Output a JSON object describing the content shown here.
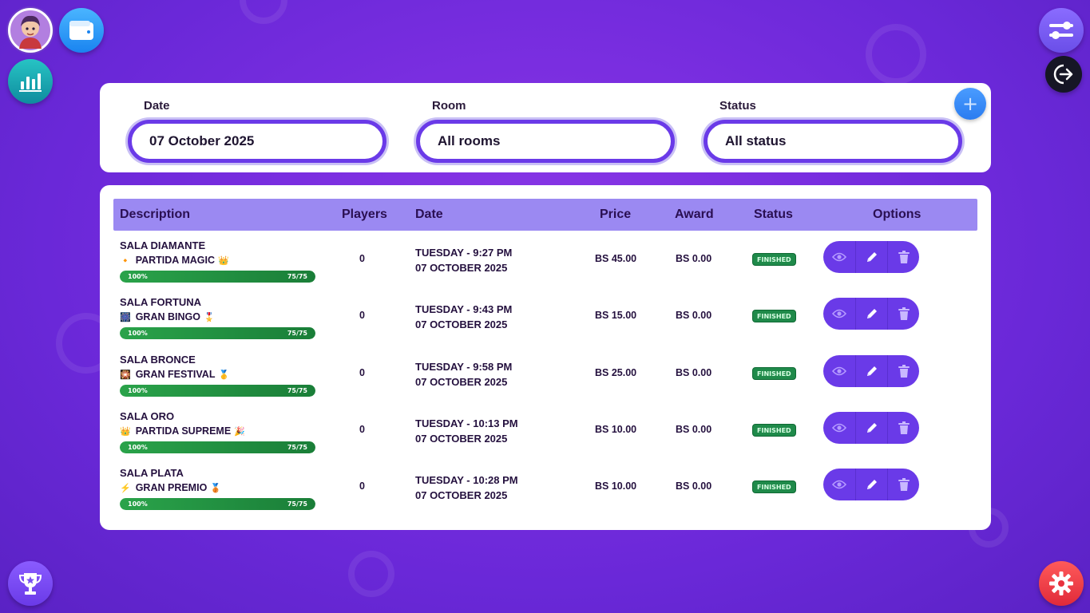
{
  "filters": {
    "date": {
      "label": "Date",
      "value": "07 October 2025"
    },
    "room": {
      "label": "Room",
      "value": "All rooms"
    },
    "status": {
      "label": "Status",
      "value": "All status"
    },
    "add_label": "+"
  },
  "table": {
    "headers": {
      "description": "Description",
      "players": "Players",
      "date": "Date",
      "price": "Price",
      "award": "Award",
      "status": "Status",
      "options": "Options"
    },
    "rows": [
      {
        "sala": "SALA DIAMANTE",
        "icon": "🔸",
        "game": "PARTIDA MAGIC",
        "icon2": "👑",
        "progress_pct": "100%",
        "progress_count": "75/75",
        "progress": 1.0,
        "players": "0",
        "day": "TUESDAY - 9:27 PM",
        "date": "07 OCTOBER 2025",
        "price": "BS 45.00",
        "award": "BS 0.00",
        "status": "FINISHED"
      },
      {
        "sala": "SALA FORTUNA",
        "icon": "🎆",
        "game": "GRAN BINGO",
        "icon2": "🎖️",
        "progress_pct": "100%",
        "progress_count": "75/75",
        "progress": 1.0,
        "players": "0",
        "day": "TUESDAY - 9:43 PM",
        "date": "07 OCTOBER 2025",
        "price": "BS 15.00",
        "award": "BS 0.00",
        "status": "FINISHED"
      },
      {
        "sala": "SALA BRONCE",
        "icon": "🎇",
        "game": "GRAN FESTIVAL",
        "icon2": "🥇",
        "progress_pct": "100%",
        "progress_count": "75/75",
        "progress": 1.0,
        "players": "0",
        "day": "TUESDAY - 9:58 PM",
        "date": "07 OCTOBER 2025",
        "price": "BS 25.00",
        "award": "BS 0.00",
        "status": "FINISHED"
      },
      {
        "sala": "SALA ORO",
        "icon": "👑",
        "game": "PARTIDA SUPREME",
        "icon2": "🎉",
        "progress_pct": "100%",
        "progress_count": "75/75",
        "progress": 1.0,
        "players": "0",
        "day": "TUESDAY - 10:13 PM",
        "date": "07 OCTOBER 2025",
        "price": "BS 10.00",
        "award": "BS 0.00",
        "status": "FINISHED"
      },
      {
        "sala": "SALA PLATA",
        "icon": "⚡",
        "game": "GRAN PREMIO",
        "icon2": "🥉",
        "progress_pct": "100%",
        "progress_count": "75/75",
        "progress": 1.0,
        "players": "0",
        "day": "TUESDAY - 10:28 PM",
        "date": "07 OCTOBER 2025",
        "price": "BS 10.00",
        "award": "BS 0.00",
        "status": "FINISHED"
      }
    ]
  },
  "icons": {
    "avatar": "user-avatar",
    "wallet": "wallet-icon",
    "stats": "bar-chart-icon",
    "trophy": "trophy-icon",
    "filter": "sliders-icon",
    "logout": "logout-icon",
    "settings": "gear-icon"
  },
  "colors": {
    "accent": "#6a3ae8",
    "header": "#9b89f2",
    "status_finished": "#1f8a4a",
    "progress": "#2aa34a"
  }
}
